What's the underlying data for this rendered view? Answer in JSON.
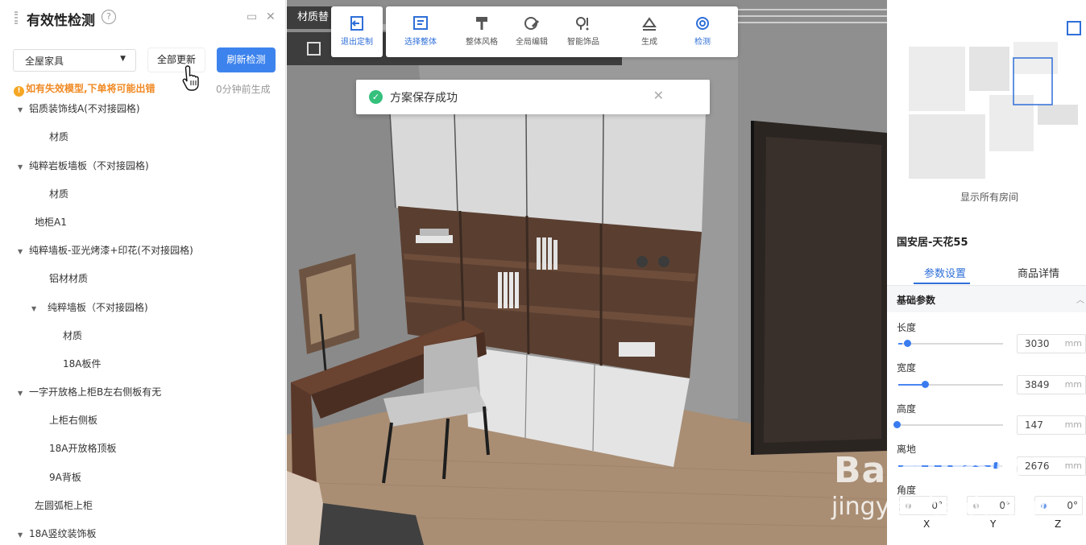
{
  "left_panel": {
    "title": "有效性检测",
    "help": "?",
    "select_value": "全屋家具",
    "update_all": "全部更新",
    "refresh": "刷新检测",
    "warning": "如有失效模型,下单将可能出错",
    "warning_icon": "!",
    "generated": "0分钟前生成",
    "tree": [
      {
        "label": "铝质装饰线A(不对接园格)",
        "expanded": true,
        "depth": 0
      },
      {
        "label": "材质",
        "depth": 1
      },
      {
        "label": "纯粹岩板墙板（不对接园格)",
        "expanded": true,
        "depth": 0
      },
      {
        "label": "材质",
        "depth": 1
      },
      {
        "label": "地柜A1",
        "depth": 0
      },
      {
        "label": "纯粹墙板-亚光烤漆+印花(不对接园格)",
        "expanded": true,
        "depth": 0
      },
      {
        "label": "铝材材质",
        "depth": 1
      },
      {
        "label": "纯粹墙板（不对接园格)",
        "expanded": true,
        "depth": 1
      },
      {
        "label": "材质",
        "depth": 2
      },
      {
        "label": "18A板件",
        "depth": 2
      },
      {
        "label": "一字开放格上柜B左右侧板有无",
        "expanded": true,
        "depth": 0
      },
      {
        "label": "上柜右侧板",
        "depth": 1
      },
      {
        "label": "18A开放格顶板",
        "depth": 1
      },
      {
        "label": "9A背板",
        "depth": 1
      },
      {
        "label": "左圆弧柜上柜",
        "depth": 0
      },
      {
        "label": "18A竖纹装饰板",
        "expanded": true,
        "depth": 0
      }
    ]
  },
  "viewport": {
    "tab_label": "材质替",
    "toast": "方案保存成功",
    "toast_close": "✕",
    "tools": [
      {
        "label": "退出定制",
        "icon": "exit-icon",
        "active": true
      },
      {
        "label": "选择整体",
        "icon": "select-all-icon",
        "active": true
      },
      {
        "label": "整体风格",
        "icon": "style-roller-icon",
        "active": false
      },
      {
        "label": "全局编辑",
        "icon": "global-edit-icon",
        "active": false
      },
      {
        "label": "智能饰品",
        "icon": "smart-decor-icon",
        "active": false
      },
      {
        "label": "生成",
        "icon": "generate-icon",
        "active": false
      },
      {
        "label": "检测",
        "icon": "detect-icon",
        "active": true
      }
    ]
  },
  "minimap": {
    "label": "显示所有房间"
  },
  "properties": {
    "title": "国安居-天花55",
    "tab_param": "参数设置",
    "tab_goods": "商品详情",
    "section": "基础参数",
    "params": [
      {
        "label": "长度",
        "value": "3030",
        "unit": "mm",
        "level": 0.04
      },
      {
        "label": "宽度",
        "value": "3849",
        "unit": "mm",
        "level": 0.27
      },
      {
        "label": "高度",
        "value": "147",
        "unit": "mm",
        "level": 0.0
      },
      {
        "label": "离地",
        "value": "2676",
        "unit": "mm",
        "level": 0.9
      }
    ],
    "angle_label": "角度",
    "angles": [
      {
        "axis": "X",
        "value": "0°"
      },
      {
        "axis": "Y",
        "value": "0°"
      },
      {
        "axis": "Z",
        "value": "0°"
      }
    ]
  },
  "watermark": {
    "brand": "Baidu经验",
    "url": "jingyan.baidu.com"
  },
  "colors": {
    "accent": "#3d83ed",
    "warning": "#f08a24",
    "success": "#35c07c"
  }
}
